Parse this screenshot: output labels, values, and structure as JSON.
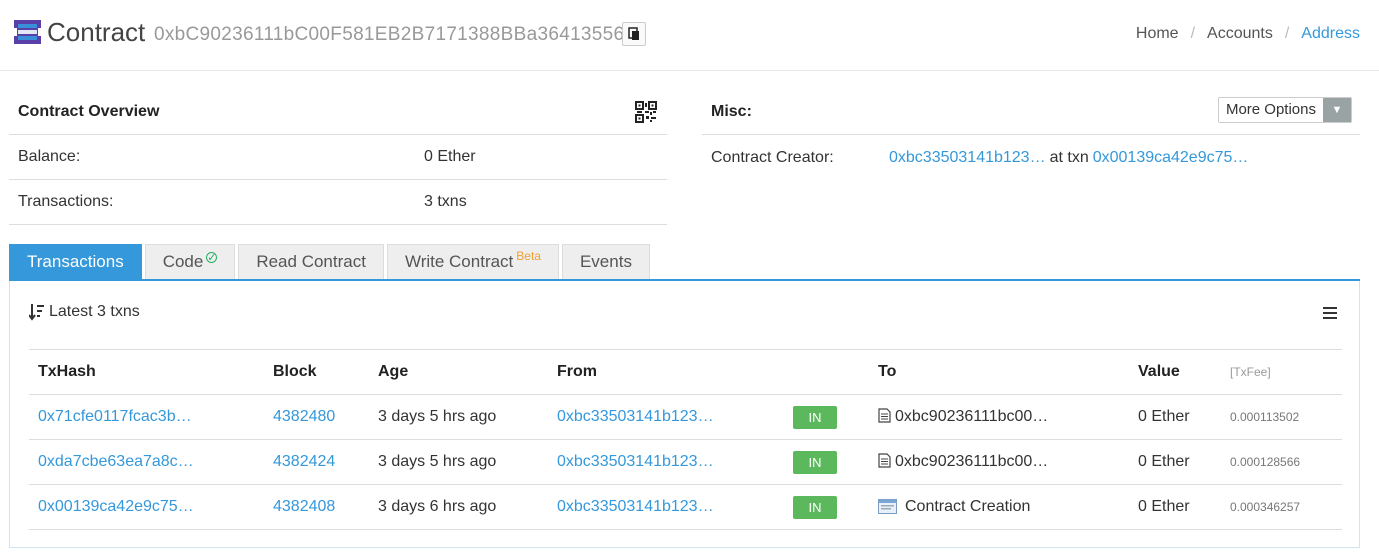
{
  "header": {
    "title": "Contract",
    "address": "0xbC90236111bC00F581EB2B7171388BBa36413556",
    "breadcrumb": [
      "Home",
      "Accounts",
      "Address"
    ]
  },
  "overview": {
    "title": "Contract Overview",
    "rows": [
      {
        "label": "Balance:",
        "value": "0 Ether"
      },
      {
        "label": "Transactions:",
        "value": "3 txns"
      }
    ]
  },
  "misc": {
    "title": "Misc:",
    "more_options_label": "More Options",
    "creator_label": "Contract Creator:",
    "creator_address": "0xbc33503141b123…",
    "at_txn_text": "at txn",
    "creator_txn": "0x00139ca42e9c75…"
  },
  "tabs": [
    {
      "label": "Transactions",
      "active": true
    },
    {
      "label": "Code",
      "verified": true
    },
    {
      "label": "Read Contract"
    },
    {
      "label": "Write Contract",
      "badge": "Beta"
    },
    {
      "label": "Events"
    }
  ],
  "transactions": {
    "summary": "Latest 3 txns",
    "columns": [
      "TxHash",
      "Block",
      "Age",
      "From",
      "",
      "To",
      "Value",
      "[TxFee]"
    ],
    "rows": [
      {
        "hash": "0x71cfe0117fcac3b…",
        "block": "4382480",
        "age": "3 days 5 hrs ago",
        "from": "0xbc33503141b123…",
        "direction": "IN",
        "to": "0xbc90236111bc00…",
        "to_type": "contract",
        "value": "0 Ether",
        "fee": "0.000113502"
      },
      {
        "hash": "0xda7cbe63ea7a8c…",
        "block": "4382424",
        "age": "3 days 5 hrs ago",
        "from": "0xbc33503141b123…",
        "direction": "IN",
        "to": "0xbc90236111bc00…",
        "to_type": "contract",
        "value": "0 Ether",
        "fee": "0.000128566"
      },
      {
        "hash": "0x00139ca42e9c75…",
        "block": "4382408",
        "age": "3 days 6 hrs ago",
        "from": "0xbc33503141b123…",
        "direction": "IN",
        "to": "Contract Creation",
        "to_type": "creation",
        "value": "0 Ether",
        "fee": "0.000346257"
      }
    ]
  },
  "colors": {
    "accent": "#3498db",
    "in_badge": "#5cb85c",
    "beta": "#f0a030"
  }
}
